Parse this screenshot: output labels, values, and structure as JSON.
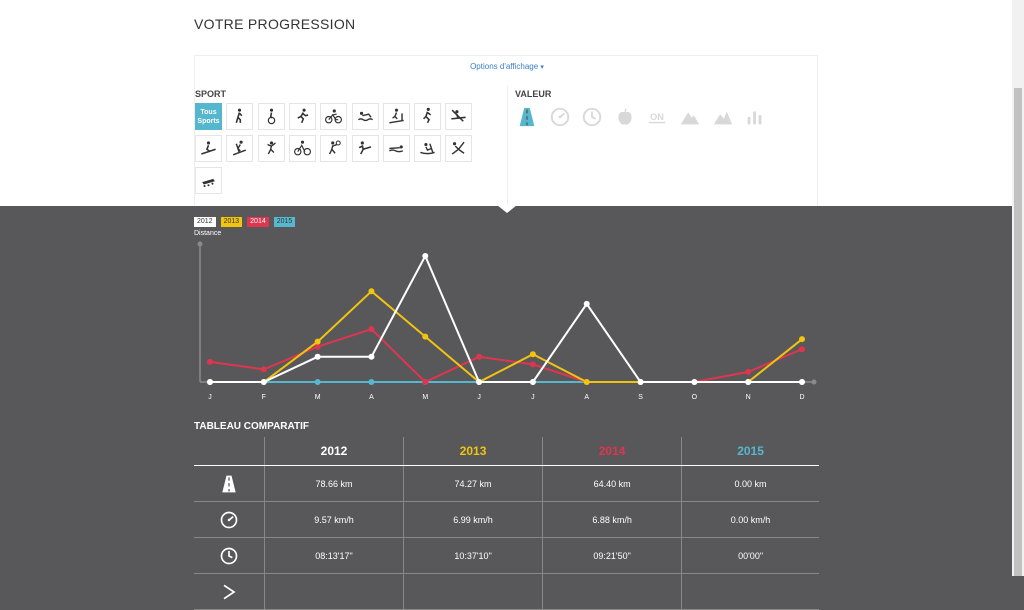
{
  "page_title": "VOTRE PROGRESSION",
  "options_toggle": "Options d'affichage",
  "sport_label": "SPORT",
  "valeur_label": "VALEUR",
  "all_sports_button": {
    "line1": "Tous",
    "line2": "Sports"
  },
  "sport_icons": [
    "walking-icon",
    "cycling-icon",
    "running-icon",
    "bike-icon",
    "swimming-icon",
    "treadmill-icon",
    "skating-icon",
    "kayak-icon",
    "snowboard-icon",
    "ski-icon",
    "climbing-icon",
    "mountain-bike-icon",
    "tennis-icon",
    "martial-arts-icon",
    "swim-crawl-icon",
    "rowing-icon",
    "yoga-icon",
    "rollerblade-icon"
  ],
  "valeur_icons": [
    "distance-icon",
    "speed-icon",
    "duration-icon",
    "calories-icon",
    "on-icon",
    "altitude-up-icon",
    "altitude-down-icon",
    "stats-icon"
  ],
  "colors": {
    "2012": "#ffffff",
    "2013": "#f1c40f",
    "2014": "#e0354e",
    "2015": "#56b8cf",
    "selected": "#55b7ce"
  },
  "chart_data": {
    "type": "line",
    "title": "",
    "xlabel": "",
    "ylabel": "Distance",
    "categories": [
      "J",
      "F",
      "M",
      "A",
      "M",
      "J",
      "J",
      "A",
      "S",
      "O",
      "N",
      "D"
    ],
    "ylim": [
      0,
      50
    ],
    "legend_position": "top-left",
    "grid": false,
    "series": [
      {
        "name": "2012",
        "values": [
          0,
          0,
          10,
          10,
          50,
          0,
          0,
          31,
          0,
          0,
          0,
          0
        ]
      },
      {
        "name": "2013",
        "values": [
          0,
          0,
          16,
          36,
          18,
          0,
          11,
          0,
          0,
          0,
          0,
          17
        ]
      },
      {
        "name": "2014",
        "values": [
          8,
          5,
          14,
          21,
          0,
          10,
          7,
          0,
          0,
          0,
          4,
          13
        ]
      },
      {
        "name": "2015",
        "values": [
          0,
          0,
          0,
          0,
          0,
          0,
          0,
          0,
          0,
          0,
          0,
          0
        ]
      }
    ]
  },
  "table": {
    "title": "TABLEAU COMPARATIF",
    "headers": [
      "2012",
      "2013",
      "2014",
      "2015"
    ],
    "rows": [
      {
        "icon": "distance-icon",
        "values": [
          "78.66 km",
          "74.27 km",
          "64.40 km",
          "0.00 km"
        ]
      },
      {
        "icon": "speed-icon",
        "values": [
          "9.57 km/h",
          "6.99 km/h",
          "6.88 km/h",
          "0.00 km/h"
        ]
      },
      {
        "icon": "duration-icon",
        "values": [
          "08:13'17\"",
          "10:37'10\"",
          "09:21'50\"",
          "00'00\""
        ]
      },
      {
        "icon": "pace-icon",
        "values": [
          "",
          "",
          "",
          ""
        ]
      }
    ]
  }
}
